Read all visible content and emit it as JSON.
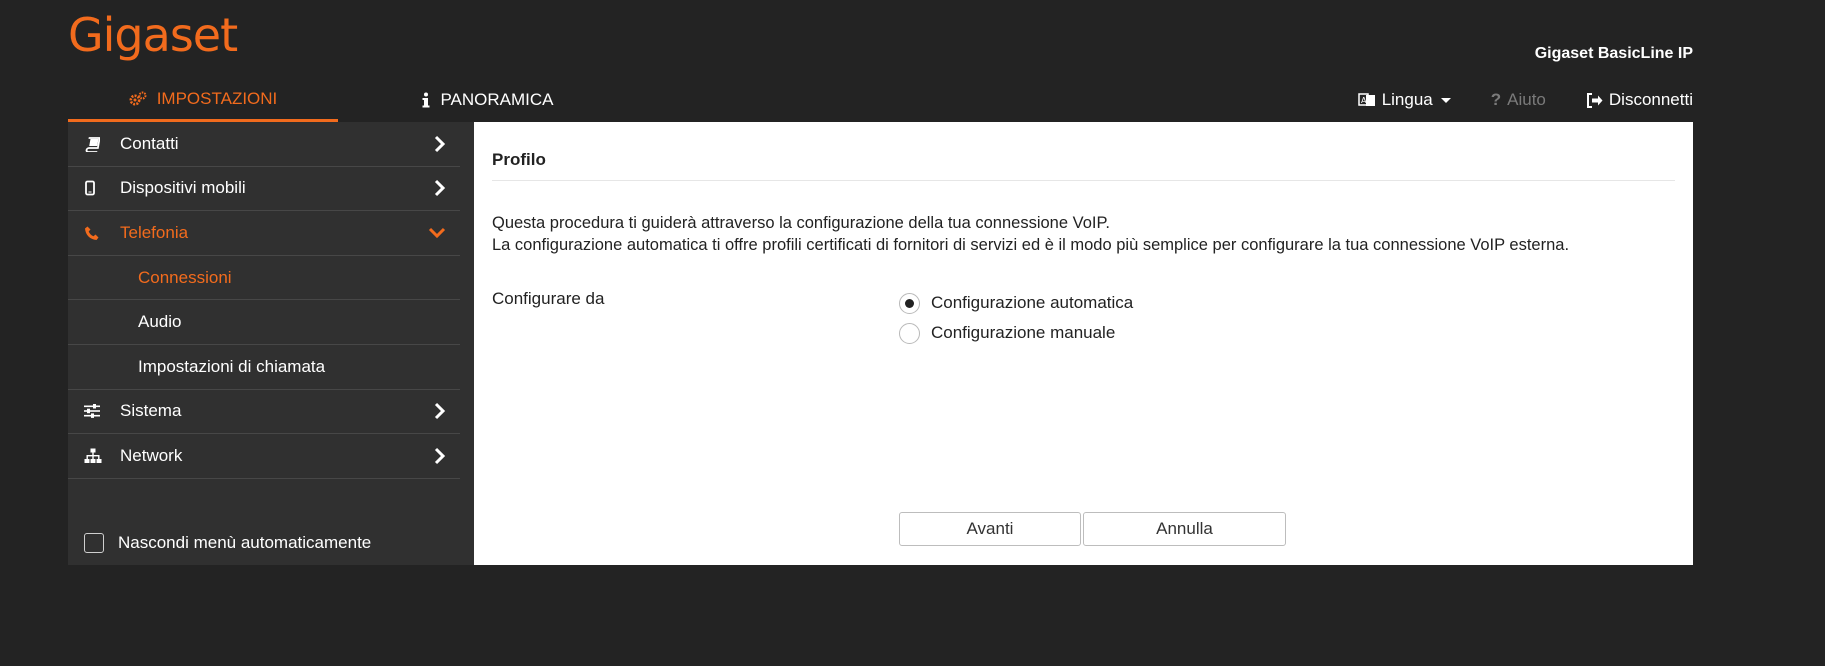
{
  "brand": {
    "logo_text": "Gigaset",
    "product": "Gigaset BasicLine IP",
    "accent": "#f26b1d"
  },
  "topnav": {
    "tabs": [
      {
        "label": "IMPOSTAZIONI",
        "icon": "gears-icon",
        "active": true
      },
      {
        "label": "PANORAMICA",
        "icon": "info-icon",
        "active": false
      }
    ],
    "language": "Lingua",
    "help": "Aiuto",
    "logout": "Disconnetti"
  },
  "sidebar": {
    "items": [
      {
        "label": "Contatti",
        "icon": "book-icon"
      },
      {
        "label": "Dispositivi mobili",
        "icon": "handset-icon"
      },
      {
        "label": "Telefonia",
        "icon": "phone-icon",
        "expanded": true,
        "children": [
          {
            "label": "Connessioni",
            "active": true
          },
          {
            "label": "Audio"
          },
          {
            "label": "Impostazioni di chiamata"
          }
        ]
      },
      {
        "label": "Sistema",
        "icon": "sliders-icon"
      },
      {
        "label": "Network",
        "icon": "sitemap-icon"
      }
    ],
    "autohide_label": "Nascondi menù automaticamente"
  },
  "content": {
    "title": "Profilo",
    "desc_line1": "Questa procedura ti guiderà attraverso la configurazione della tua connessione VoIP.",
    "desc_line2": "La configurazione automatica ti offre profili certificati di fornitori di servizi ed è il modo più semplice per configurare la tua connessione VoIP esterna.",
    "config_label": "Configurare da",
    "options": [
      {
        "label": "Configurazione automatica",
        "checked": true
      },
      {
        "label": "Configurazione manuale",
        "checked": false
      }
    ],
    "next_label": "Avanti",
    "cancel_label": "Annulla"
  }
}
